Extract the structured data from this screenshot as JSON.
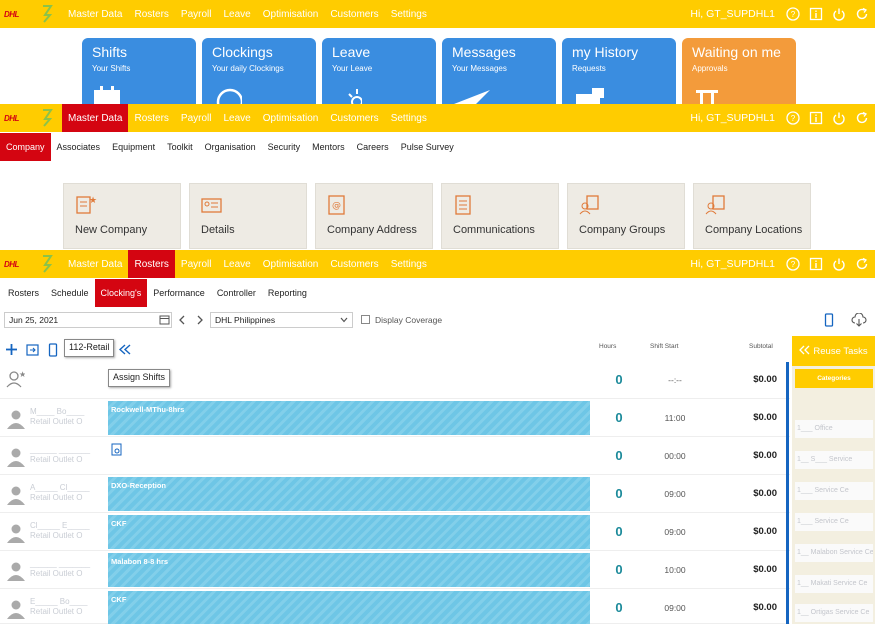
{
  "brand": {
    "logo_text": "DHL",
    "accent": "#ffcc00",
    "red": "#d40511"
  },
  "nav1": {
    "items": [
      "Master Data",
      "Rosters",
      "Payroll",
      "Leave",
      "Optimisation",
      "Customers",
      "Settings"
    ],
    "greeting": "Hi, GT_SUPDHL1"
  },
  "tiles": [
    {
      "title": "Shifts",
      "subtitle": "Your Shifts"
    },
    {
      "title": "Clockings",
      "subtitle": "Your daily Clockings"
    },
    {
      "title": "Leave",
      "subtitle": "Your Leave"
    },
    {
      "title": "Messages",
      "subtitle": "Your Messages"
    },
    {
      "title": "my History",
      "subtitle": "Requests"
    },
    {
      "title": "Waiting on me",
      "subtitle": "Approvals"
    }
  ],
  "nav2": {
    "items": [
      "Master Data",
      "Rosters",
      "Payroll",
      "Leave",
      "Optimisation",
      "Customers",
      "Settings"
    ],
    "greeting": "Hi, GT_SUPDHL1",
    "active": "Master Data"
  },
  "subnav2": {
    "items": [
      "Company",
      "Associates",
      "Equipment",
      "Toolkit",
      "Organisation",
      "Security",
      "Mentors",
      "Careers",
      "Pulse Survey"
    ],
    "active": "Company"
  },
  "cards": [
    "New Company",
    "Details",
    "Company Address",
    "Communications",
    "Company Groups",
    "Company Locations"
  ],
  "nav3": {
    "items": [
      "Master Data",
      "Rosters",
      "Payroll",
      "Leave",
      "Optimisation",
      "Customers",
      "Settings"
    ],
    "greeting": "Hi, GT_SUPDHL1",
    "active": "Rosters"
  },
  "subnav3": {
    "items": [
      "Rosters",
      "Schedule",
      "Clocking's",
      "Performance",
      "Controller",
      "Reporting"
    ],
    "active": "Clocking's"
  },
  "filters": {
    "date": "Jun 25, 2021",
    "location": "DHL Philippines",
    "coverage_label": "Display Coverage"
  },
  "toolbar": {
    "group": "112-Retail",
    "assign_label": "Assign Shifts"
  },
  "columns": {
    "hours": "Hours",
    "shift_start": "Shift Start",
    "subtotal": "Subtotal"
  },
  "summary": {
    "hours": "0",
    "start": "--:--",
    "subtotal": "$0.00"
  },
  "rows": [
    {
      "name": "M____ Bo____",
      "sub": "Retail Outlet O",
      "shift": "Rockwell-MThu-8hrs",
      "hours": "0",
      "start": "11:00",
      "subtotal": "$0.00",
      "bar": true
    },
    {
      "name": "______ _______",
      "sub": "Retail Outlet O",
      "shift": "",
      "hours": "0",
      "start": "00:00",
      "subtotal": "$0.00",
      "bar": false
    },
    {
      "name": "A_____ Cl_____",
      "sub": "Retail Outlet O",
      "shift": "DXO-Reception",
      "hours": "0",
      "start": "09:00",
      "subtotal": "$0.00",
      "bar": true
    },
    {
      "name": "Cl_____ E_____",
      "sub": "Retail Outlet O",
      "shift": "CKF",
      "hours": "0",
      "start": "09:00",
      "subtotal": "$0.00",
      "bar": true
    },
    {
      "name": "______ _______",
      "sub": "Retail Outlet O",
      "shift": "Malabon 8-8 hrs",
      "hours": "0",
      "start": "10:00",
      "subtotal": "$0.00",
      "bar": true
    },
    {
      "name": "E_____ Bo____",
      "sub": "Retail Outlet O",
      "shift": "CKF",
      "hours": "0",
      "start": "09:00",
      "subtotal": "$0.00",
      "bar": true
    }
  ],
  "reuse": {
    "title": "Reuse Tasks",
    "category": "Categories",
    "items": [
      "1___ Office",
      "1__ S___ Service",
      "1___ Service Ce",
      "1___ Service Ce",
      "1__ Malabon Service Ce",
      "1__ Makati Service Ce",
      "1__ Ortigas Service Ce"
    ]
  }
}
